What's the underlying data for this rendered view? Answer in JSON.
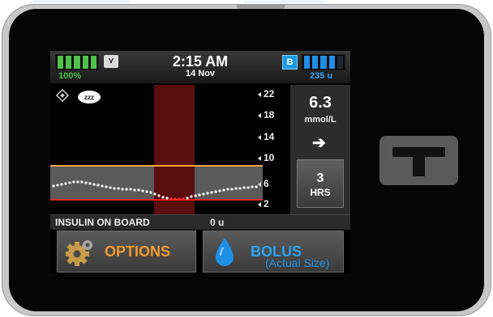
{
  "status": {
    "battery_percent": "100%",
    "antenna_icon": "antenna-icon",
    "time": "2:15 AM",
    "date": "14 Nov",
    "bolus_badge": "B",
    "insulin_units": "235 u"
  },
  "graph": {
    "sleep_label": "zzz",
    "axis_ticks": [
      "22",
      "18",
      "14",
      "10",
      "6",
      "2"
    ],
    "high_line_color": "#f0a43a",
    "low_line_color": "#e0242a",
    "suspend_band_color": "#5a0e0e"
  },
  "reading": {
    "value": "6.3",
    "unit": "mmol/L",
    "trend_icon": "right-arrow-icon",
    "hours_value": "3",
    "hours_label": "HRS"
  },
  "iob": {
    "label": "INSULIN ON BOARD",
    "value": "0 u"
  },
  "buttons": {
    "options_label": "OPTIONS",
    "bolus_label": "BOLUS"
  },
  "caption": "(Actual Size)"
}
